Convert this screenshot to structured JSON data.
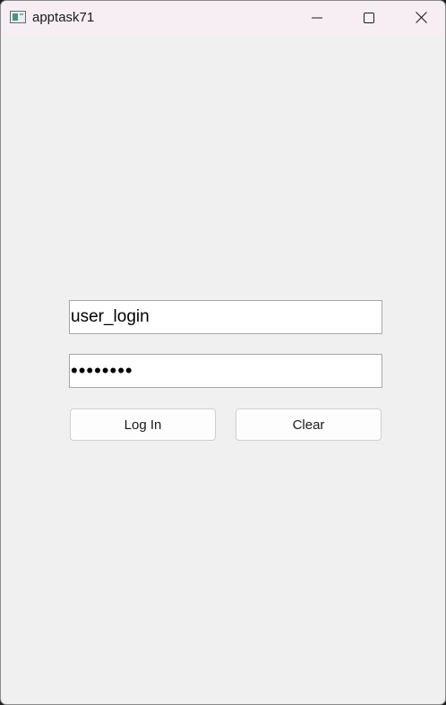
{
  "window": {
    "title": "apptask71"
  },
  "form": {
    "username_value": "user_login",
    "password_value": "••••••••"
  },
  "buttons": {
    "login_label": "Log In",
    "clear_label": "Clear"
  },
  "colors": {
    "titlebar_bg": "#f7eef3",
    "window_bg": "#f0f0f0",
    "field_border": "#a6a6a6",
    "button_bg": "#fdfdfd"
  }
}
